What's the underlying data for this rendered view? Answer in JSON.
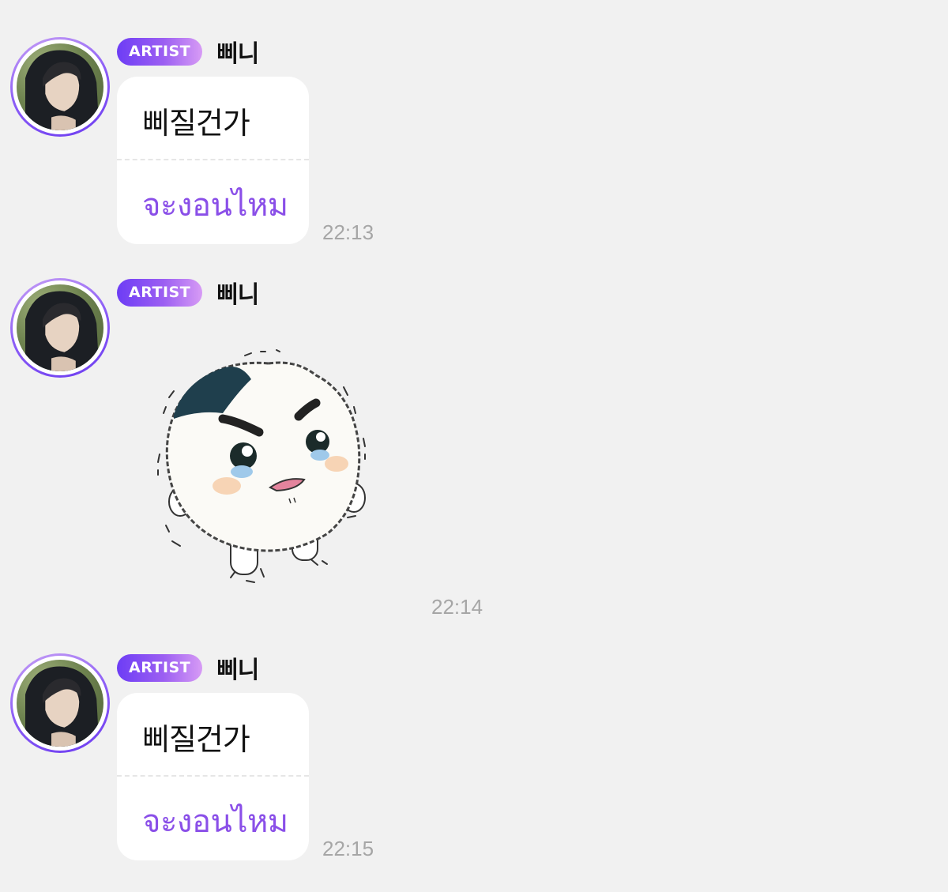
{
  "messages": [
    {
      "type": "text",
      "badge": "ARTIST",
      "sender": "삐니",
      "text": "삐질건가",
      "translation": "จะงอนไหม",
      "time": "22:13"
    },
    {
      "type": "sticker",
      "badge": "ARTIST",
      "sender": "삐니",
      "sticker_icon": "crying-rice-ball-sticker",
      "time": "22:14"
    },
    {
      "type": "text",
      "badge": "ARTIST",
      "sender": "삐니",
      "text": "삐질건가",
      "translation": "จะงอนไหม",
      "time": "22:15"
    }
  ],
  "colors": {
    "background": "#f1f1f1",
    "bubble": "#ffffff",
    "translation_text": "#8a4fe8",
    "badge_gradient_start": "#6d3df5",
    "badge_gradient_end": "#d79bf5",
    "timestamp": "#a6a6a6"
  }
}
